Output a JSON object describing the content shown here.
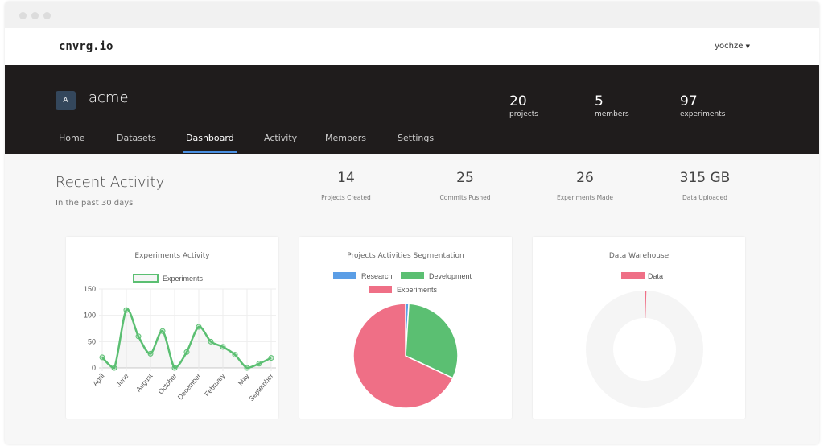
{
  "app": {
    "logo": "cnvrg.io",
    "user": "yochze",
    "user_menu_icon": "caret-down-icon"
  },
  "org": {
    "initial": "A",
    "name": "acme",
    "stats": [
      {
        "value": "20",
        "label": "projects"
      },
      {
        "value": "5",
        "label": "members"
      },
      {
        "value": "97",
        "label": "experiments"
      }
    ],
    "tabs": [
      {
        "label": "Home"
      },
      {
        "label": "Datasets"
      },
      {
        "label": "Dashboard",
        "active": true
      },
      {
        "label": "Activity"
      },
      {
        "label": "Members"
      },
      {
        "label": "Settings"
      }
    ]
  },
  "recent": {
    "title": "Recent Activity",
    "subtitle": "In the past 30 days",
    "stats": [
      {
        "value": "14",
        "label": "Projects Created"
      },
      {
        "value": "25",
        "label": "Commits Pushed"
      },
      {
        "value": "26",
        "label": "Experiments Made"
      },
      {
        "value": "315 GB",
        "label": "Data Uploaded"
      }
    ]
  },
  "colors": {
    "header": "#1f1c1c",
    "accent": "#4a90e2",
    "research": "#5b9ee6",
    "development": "#5bbf72",
    "experiments": "#ef6f86",
    "empty": "#f5f5f5"
  },
  "chart_data": [
    {
      "type": "line",
      "title": "Experiments Activity",
      "legend": "top",
      "categories": [
        "April",
        "",
        "June",
        "",
        "August",
        "",
        "October",
        "",
        "December",
        "",
        "February",
        "",
        "May",
        "",
        "September"
      ],
      "series": [
        {
          "name": "Experiments",
          "values": [
            20,
            0,
            110,
            60,
            27,
            70,
            0,
            30,
            78,
            50,
            40,
            25,
            0,
            8,
            19
          ]
        }
      ],
      "ylim": [
        0,
        150
      ],
      "yticks": [
        0,
        50,
        100,
        150
      ],
      "grid": true
    },
    {
      "type": "pie",
      "title": "Projects Activities Segmentation",
      "legend": "top",
      "categories": [
        "Research",
        "Development",
        "Experiments"
      ],
      "values": [
        1,
        31,
        68
      ]
    },
    {
      "type": "pie",
      "variant": "doughnut",
      "title": "Data Warehouse",
      "legend": "top",
      "categories": [
        "Data"
      ],
      "values": [
        0.5
      ],
      "remainder": 99.5
    }
  ]
}
